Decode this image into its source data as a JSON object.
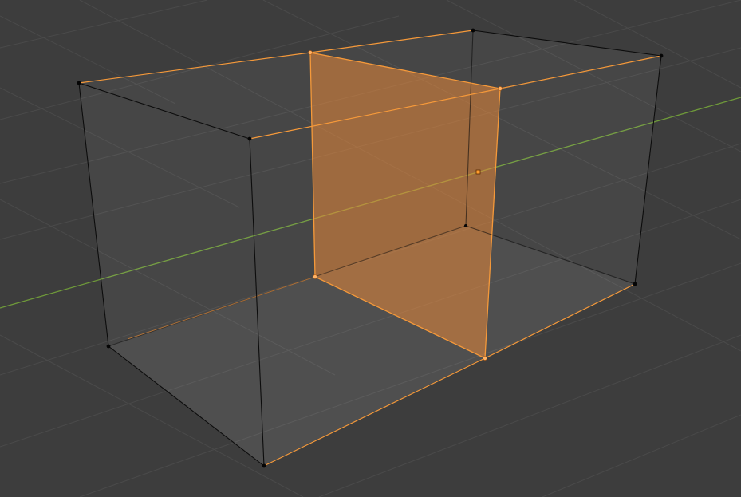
{
  "viewport": {
    "background": "#3d3d3d",
    "grid_color": "#4a4a4a",
    "axis_y_color": "#6f9a3a"
  },
  "mesh": {
    "object": "cube",
    "mode": "edit",
    "selection": "face",
    "selected_color": "#f5993a",
    "selected_face_fill": "#e8893a",
    "edge_color": "#0c0c0c",
    "vertex_count": 12,
    "selected_vertex_count": 4,
    "icons": [
      "median-point-icon"
    ]
  }
}
